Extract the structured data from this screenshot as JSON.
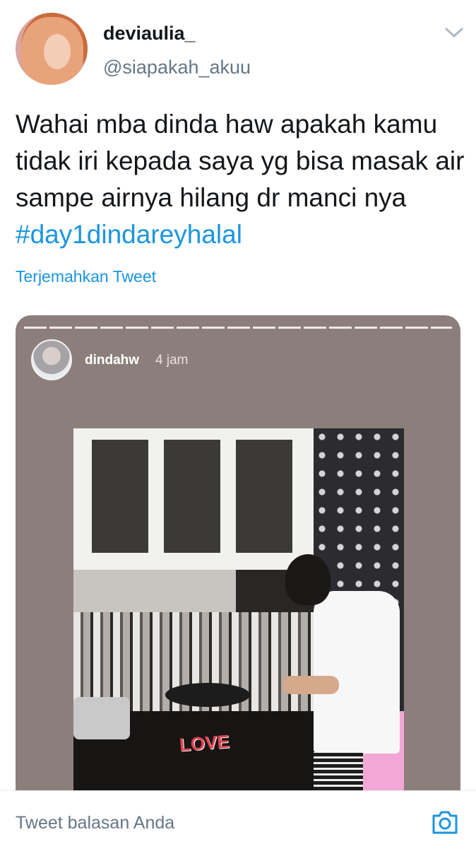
{
  "tweet": {
    "display_name": "deviaulia_",
    "handle": "@siapakah_akuu",
    "text": "Wahai mba dinda haw apakah kamu tidak iri kepada saya yg bisa masak air sampe airnya hilang dr manci nya",
    "hashtag": "#day1dindareyhalal",
    "translate_label": "Terjemahkan Tweet"
  },
  "story": {
    "username": "dindahw",
    "time": "4 jam",
    "sticker": "LOVE"
  },
  "reply": {
    "placeholder": "Tweet balasan Anda"
  },
  "colors": {
    "link": "#1b95e0",
    "secondary_text": "#657786",
    "story_background": "#8c7f7b"
  },
  "icons": {
    "caret": "chevron-down-icon",
    "camera": "camera-icon"
  }
}
